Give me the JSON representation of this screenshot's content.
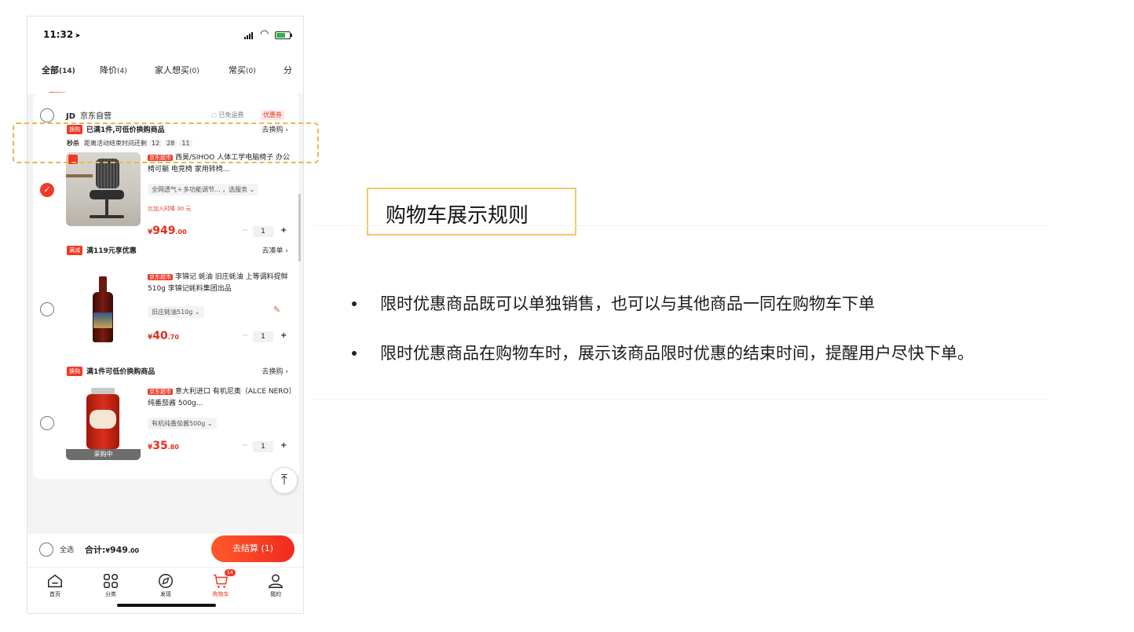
{
  "status_bar": {
    "time": "11:32"
  },
  "tabs": [
    {
      "label": "全部",
      "count": "(14)"
    },
    {
      "label": "降价",
      "count": "(4)"
    },
    {
      "label": "家人想买",
      "count": "(0)"
    },
    {
      "label": "常买",
      "count": "(0)"
    },
    {
      "label": "分",
      "count": ""
    }
  ],
  "store": {
    "logo": "JD",
    "name": "京东自营",
    "free_shipping": "已免运费",
    "coupon": "优惠券"
  },
  "promo_1": {
    "badge": "换购",
    "text": "已满1件,可低价换购商品",
    "link": "去换购 ›",
    "flash_label": "秒杀",
    "countdown_label": "距离活动结束时间还剩",
    "countdown": [
      "12",
      "28",
      "11"
    ]
  },
  "item_1": {
    "tag": "京东超市",
    "title": "西昊/SIHOO 人体工学电脑椅子 办公椅可躺 电竞椅 家用转椅...",
    "spec": "全网透气＋多功能调节... ，选服务 ⌄",
    "price_note": "比加入时降 30 元",
    "price_currency": "¥",
    "price_int": "949",
    "price_dec": ".00",
    "qty": "1"
  },
  "promo_2": {
    "badge": "满减",
    "text": "满119元享优惠",
    "link": "去凑单 ›"
  },
  "item_2": {
    "tag": "京东超市",
    "title": "李锦记 蚝油 旧庄蚝油 上等调料提鲜 510g 李锦记蚝料集团出品",
    "spec": "旧庄蚝油510g ⌄",
    "price_currency": "¥",
    "price_int": "40",
    "price_dec": ".70",
    "qty": "1"
  },
  "promo_3": {
    "badge": "换购",
    "text": "满1件可低价换购商品",
    "link": "去换购 ›"
  },
  "item_3": {
    "tag": "京东超市",
    "title": "意大利进口 有机尼奥（ALCE NERO）纯番茄酱 500g...",
    "spec": "有机纯番茄酱500g ⌄",
    "overlay": "采购中",
    "price_currency": "¥",
    "price_int": "35",
    "price_dec": ".80",
    "qty": "1"
  },
  "checkout": {
    "select_all": "全选",
    "total_label": "合计:",
    "total_currency": "¥",
    "total_int": "949",
    "total_dec": ".00",
    "button": "去结算 (1)"
  },
  "nav": [
    {
      "label": "首页",
      "icon": "home-icon"
    },
    {
      "label": "分类",
      "icon": "category-icon"
    },
    {
      "label": "发现",
      "icon": "discover-icon"
    },
    {
      "label": "购物车",
      "icon": "cart-icon",
      "badge": "14"
    },
    {
      "label": "我的",
      "icon": "profile-icon"
    }
  ],
  "colors": {
    "accent": "#ef3a26",
    "highlight_border": "#f0b646"
  },
  "panel": {
    "title": "购物车展示规则",
    "bullets": [
      "限时优惠商品既可以单独销售，也可以与其他商品一同在购物车下单",
      "限时优惠商品在购物车时，展示该商品限时优惠的结束时间，提醒用户尽快下单。"
    ]
  }
}
